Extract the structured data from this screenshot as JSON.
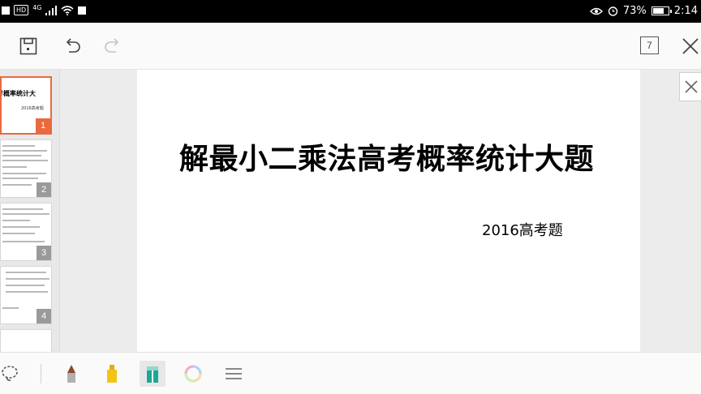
{
  "status_bar": {
    "hd_label": "HD",
    "network_label": "4G",
    "battery_percent": "73%",
    "battery_level": 0.73,
    "time": "2:14"
  },
  "toolbar": {
    "page_count": "7"
  },
  "thumbnails": [
    {
      "number": "1",
      "title": "高考概率统计大",
      "subtitle": "2016高考题"
    },
    {
      "number": "2"
    },
    {
      "number": "3"
    },
    {
      "number": "4"
    }
  ],
  "slide": {
    "title": "解最小二乘法高考概率统计大题",
    "subtitle": "2016高考题"
  },
  "colors": {
    "accent": "#e86a3e",
    "pencil_tip": "#8a4a2a",
    "marker_yellow": "#f2c418",
    "highlighter_teal": "#1aa896"
  }
}
